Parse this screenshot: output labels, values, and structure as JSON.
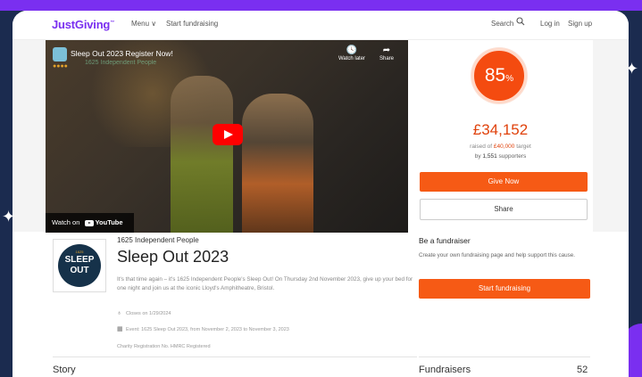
{
  "header": {
    "logo": "JustGiving",
    "logo_tm": "™",
    "menu_label": "Menu ∨",
    "start_label": "Start fundraising",
    "search_label": "Search",
    "login_label": "Log in",
    "signup_label": "Sign up"
  },
  "video": {
    "title": "Sleep Out 2023 Register Now!",
    "overlay_text": "1625 Independent People",
    "watch_later": "Watch later",
    "share": "Share",
    "watch_on": "Watch on",
    "youtube": "YouTube"
  },
  "progress": {
    "percent_value": "85",
    "percent_sign": "%",
    "amount": "£34,152",
    "raised_prefix": "raised of ",
    "target": "£40,000",
    "raised_suffix": " target",
    "supporters_prefix": "by ",
    "supporters_count": "1,551",
    "supporters_suffix": " supporters",
    "give_label": "Give Now",
    "share_label": "Share"
  },
  "page": {
    "org_name": "1625 Independent People",
    "title": "Sleep Out 2023",
    "description": "It's that time again – it's 1625 Independent People's Sleep Out! On Thursday 2nd November 2023, give up your bed for one night and join us at the iconic Lloyd's Amphitheatre, Bristol.",
    "closes": "Closes on 1/29/2024",
    "event": "Event: 1625 Sleep Out 2023, from November 2, 2023 to November 3, 2023",
    "charity_reg": "Charity Registration No. HMRC Registered",
    "story_heading": "Story",
    "logo_small": "1625",
    "logo_line1": "SLEEP",
    "logo_line2": "OUT"
  },
  "fundraiser_box": {
    "title": "Be a fundraiser",
    "text": "Create your own fundraising page and help support this cause.",
    "button": "Start fundraising",
    "fundraisers_label": "Fundraisers",
    "fundraisers_count": "52"
  },
  "colors": {
    "brand": "#7a2ff0",
    "accent": "#f65a15",
    "frame": "#1b2b4f"
  }
}
